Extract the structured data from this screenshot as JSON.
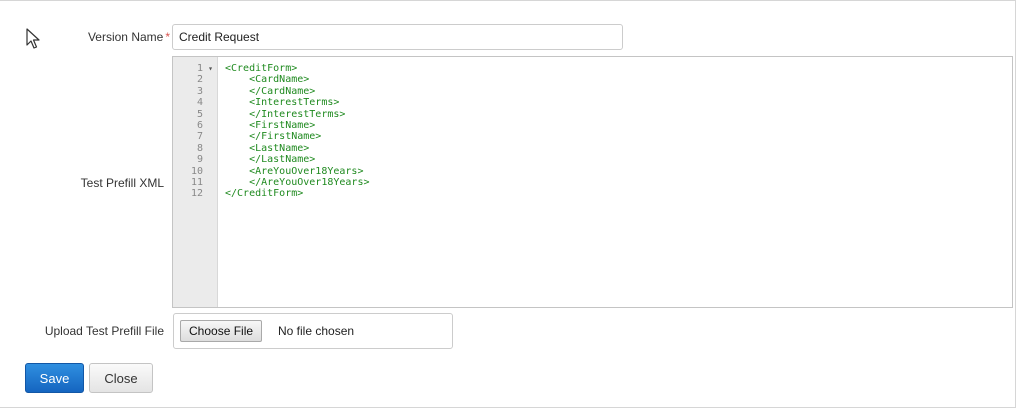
{
  "form": {
    "version_name_label": "Version Name",
    "required_marker": "*",
    "version_name_value": "Credit Request",
    "prefill_xml_label": "Test Prefill XML",
    "upload_label": "Upload Test Prefill File",
    "choose_file_label": "Choose File",
    "no_file_text": "No file chosen"
  },
  "editor": {
    "line_numbers": [
      "1",
      "2",
      "3",
      "4",
      "5",
      "6",
      "7",
      "8",
      "9",
      "10",
      "11",
      "12"
    ],
    "fold_marker": "▾",
    "lines": [
      "<CreditForm>",
      "    <CardName>",
      "    </CardName>",
      "    <InterestTerms>",
      "    </InterestTerms>",
      "    <FirstName>",
      "    </FirstName>",
      "    <LastName>",
      "    </LastName>",
      "    <AreYouOver18Years>",
      "    </AreYouOver18Years>",
      "</CreditForm>"
    ]
  },
  "actions": {
    "save_label": "Save",
    "close_label": "Close"
  },
  "colors": {
    "xml_tag": "#1f8a1f",
    "save_button": "#1565c0",
    "required_marker": "#d9534f"
  },
  "icons": {
    "cursor": "mouse-pointer-icon"
  }
}
